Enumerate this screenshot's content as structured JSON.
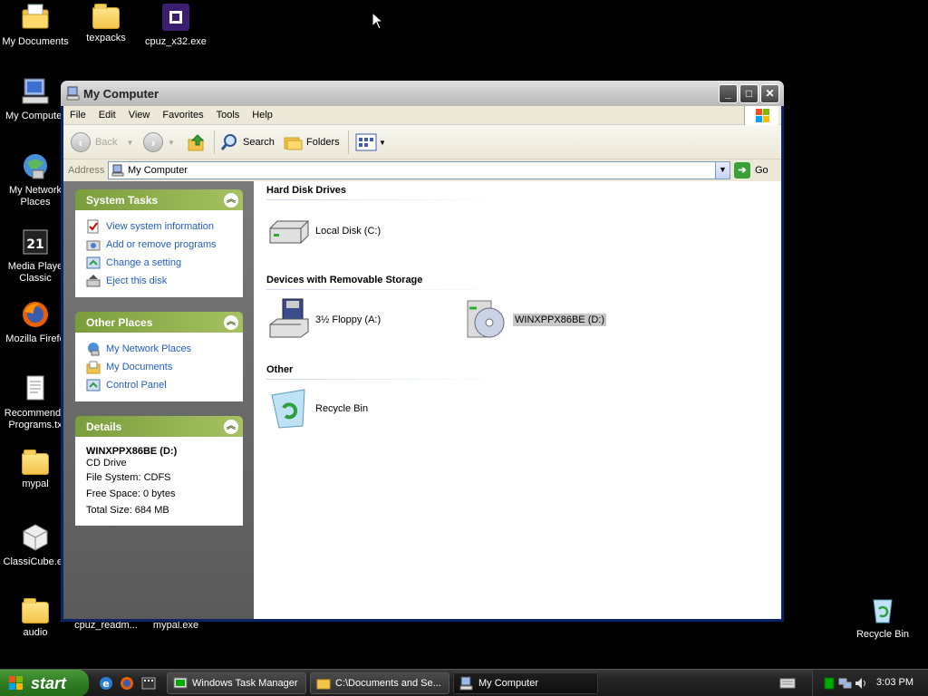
{
  "desktop": {
    "icons": [
      {
        "label": "My Documents"
      },
      {
        "label": "texpacks"
      },
      {
        "label": "cpuz_x32.exe"
      },
      {
        "label": "My Computer"
      },
      {
        "label": "My Network Places"
      },
      {
        "label": "Media Player Classic"
      },
      {
        "label": "Mozilla Firefox"
      },
      {
        "label": "Recommended Programs.txt"
      },
      {
        "label": "mypal"
      },
      {
        "label": "ClassiCube.exe"
      },
      {
        "label": "audio"
      },
      {
        "label": "cpuz_readm..."
      },
      {
        "label": "mypal.exe"
      },
      {
        "label": "Recycle Bin"
      }
    ]
  },
  "window": {
    "title": "My Computer",
    "menu": [
      "File",
      "Edit",
      "View",
      "Favorites",
      "Tools",
      "Help"
    ],
    "toolbar": {
      "back": "Back",
      "search": "Search",
      "folders": "Folders"
    },
    "address": {
      "label": "Address",
      "value": "My Computer",
      "go": "Go"
    },
    "panels": {
      "system_tasks": {
        "title": "System Tasks",
        "links": [
          "View system information",
          "Add or remove programs",
          "Change a setting",
          "Eject this disk"
        ]
      },
      "other_places": {
        "title": "Other Places",
        "links": [
          "My Network Places",
          "My Documents",
          "Control Panel"
        ]
      },
      "details": {
        "title": "Details",
        "name": "WINXPPX86BE (D:)",
        "type": "CD Drive",
        "file_system": "File System: CDFS",
        "free_space": "Free Space: 0 bytes",
        "total_size": "Total Size: 684 MB"
      }
    },
    "content": {
      "hard_disk_header": "Hard Disk Drives",
      "local_disk": "Local Disk (C:)",
      "removable_header": "Devices with Removable Storage",
      "floppy": "3½ Floppy (A:)",
      "cd_drive": "WINXPPX86BE (D:)",
      "other_header": "Other",
      "recycle_bin": "Recycle Bin"
    }
  },
  "taskbar": {
    "start": "start",
    "items": [
      "Windows Task Manager",
      "C:\\Documents and Se...",
      "My Computer"
    ],
    "clock": "3:03 PM"
  }
}
